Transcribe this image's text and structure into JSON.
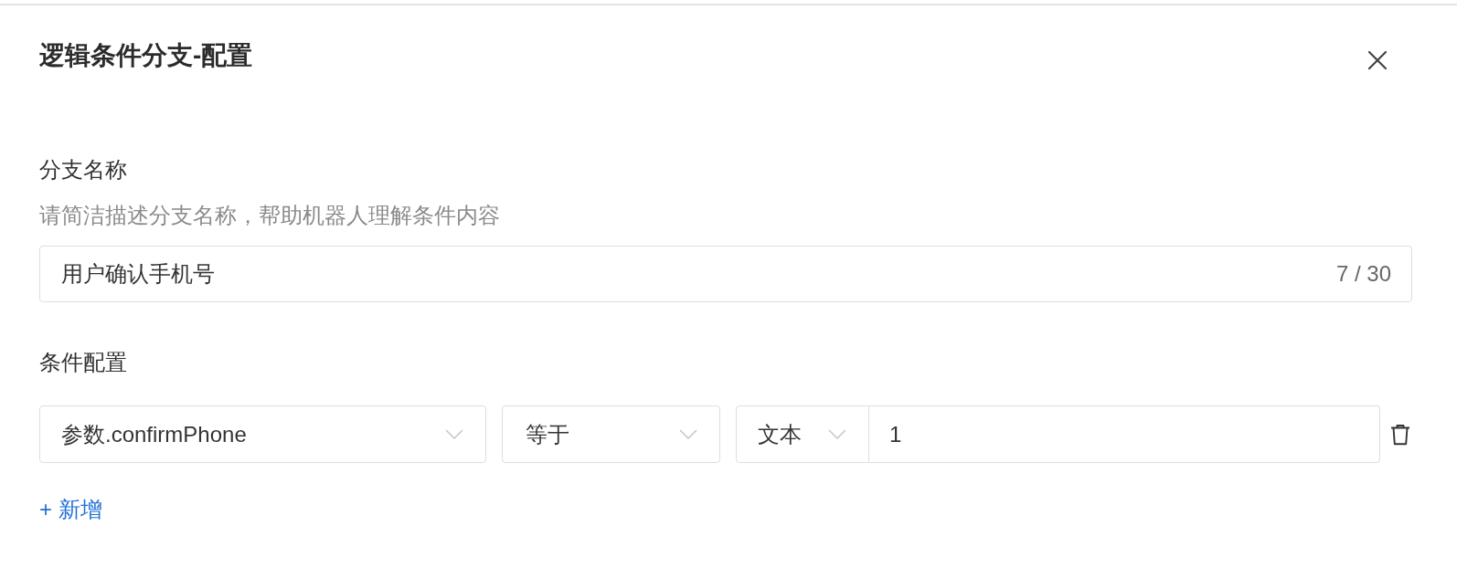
{
  "dialog": {
    "title": "逻辑条件分支-配置"
  },
  "branch_name": {
    "label": "分支名称",
    "description": "请简洁描述分支名称，帮助机器人理解条件内容",
    "value": "用户确认手机号",
    "counter": "7 / 30"
  },
  "conditions": {
    "label": "条件配置",
    "rows": [
      {
        "parameter": "参数.confirmPhone",
        "operator": "等于",
        "value_type": "文本",
        "value": "1"
      }
    ],
    "add_button": "+ 新增"
  }
}
